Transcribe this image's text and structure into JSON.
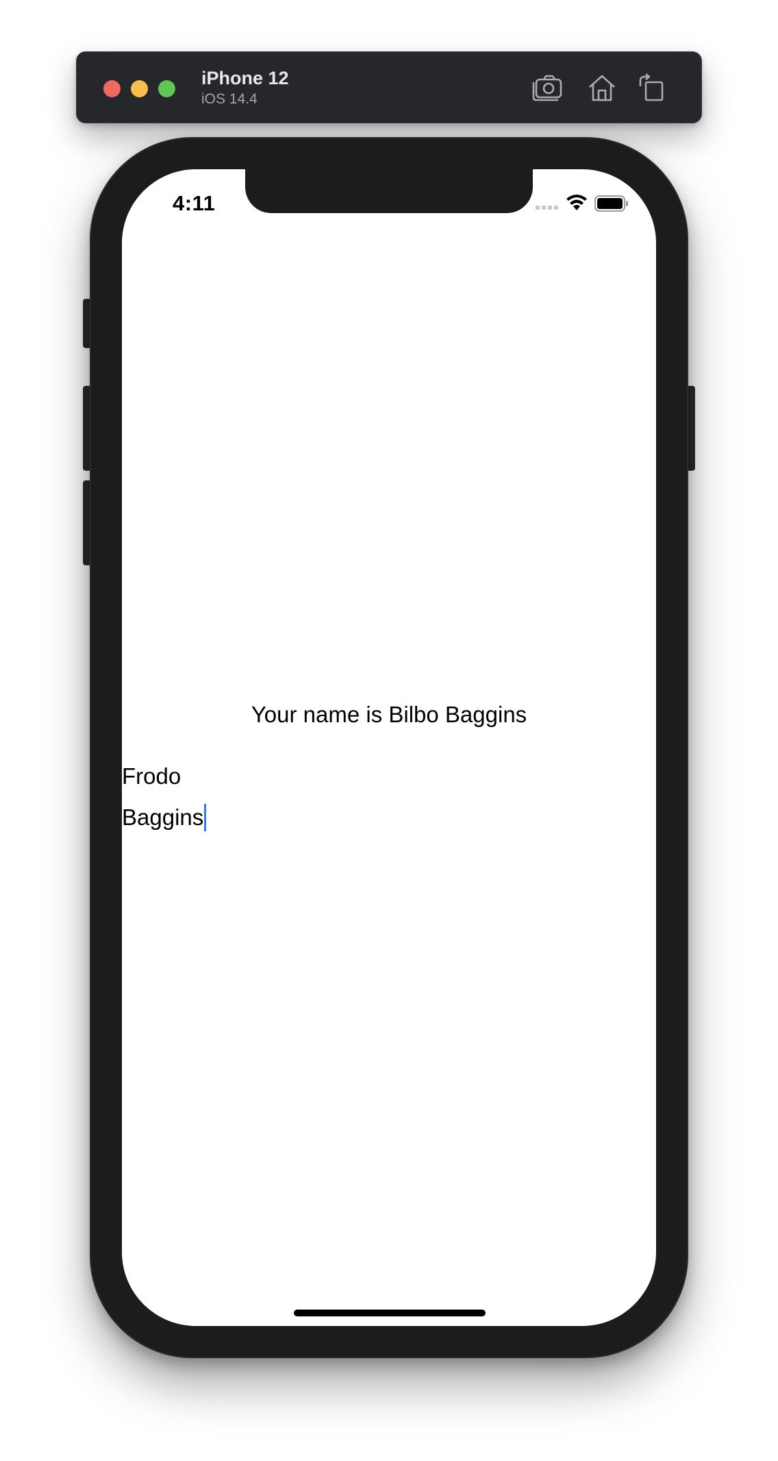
{
  "simulator": {
    "device_name": "iPhone 12",
    "os_version": "iOS 14.4",
    "toolbar_icons": [
      "screenshot-icon",
      "home-icon",
      "rotate-icon"
    ],
    "traffic_light_colors": {
      "close": "#ee6a5f",
      "minimize": "#f5be4f",
      "zoom": "#62c554"
    }
  },
  "status_bar": {
    "time": "4:11",
    "icons": [
      "signal-icon",
      "wifi-icon",
      "battery-icon"
    ]
  },
  "app": {
    "greeting": "Your name is Bilbo Baggins",
    "first_name_value": "Frodo",
    "last_name_value": "Baggins",
    "caret_color": "#3478f6"
  }
}
